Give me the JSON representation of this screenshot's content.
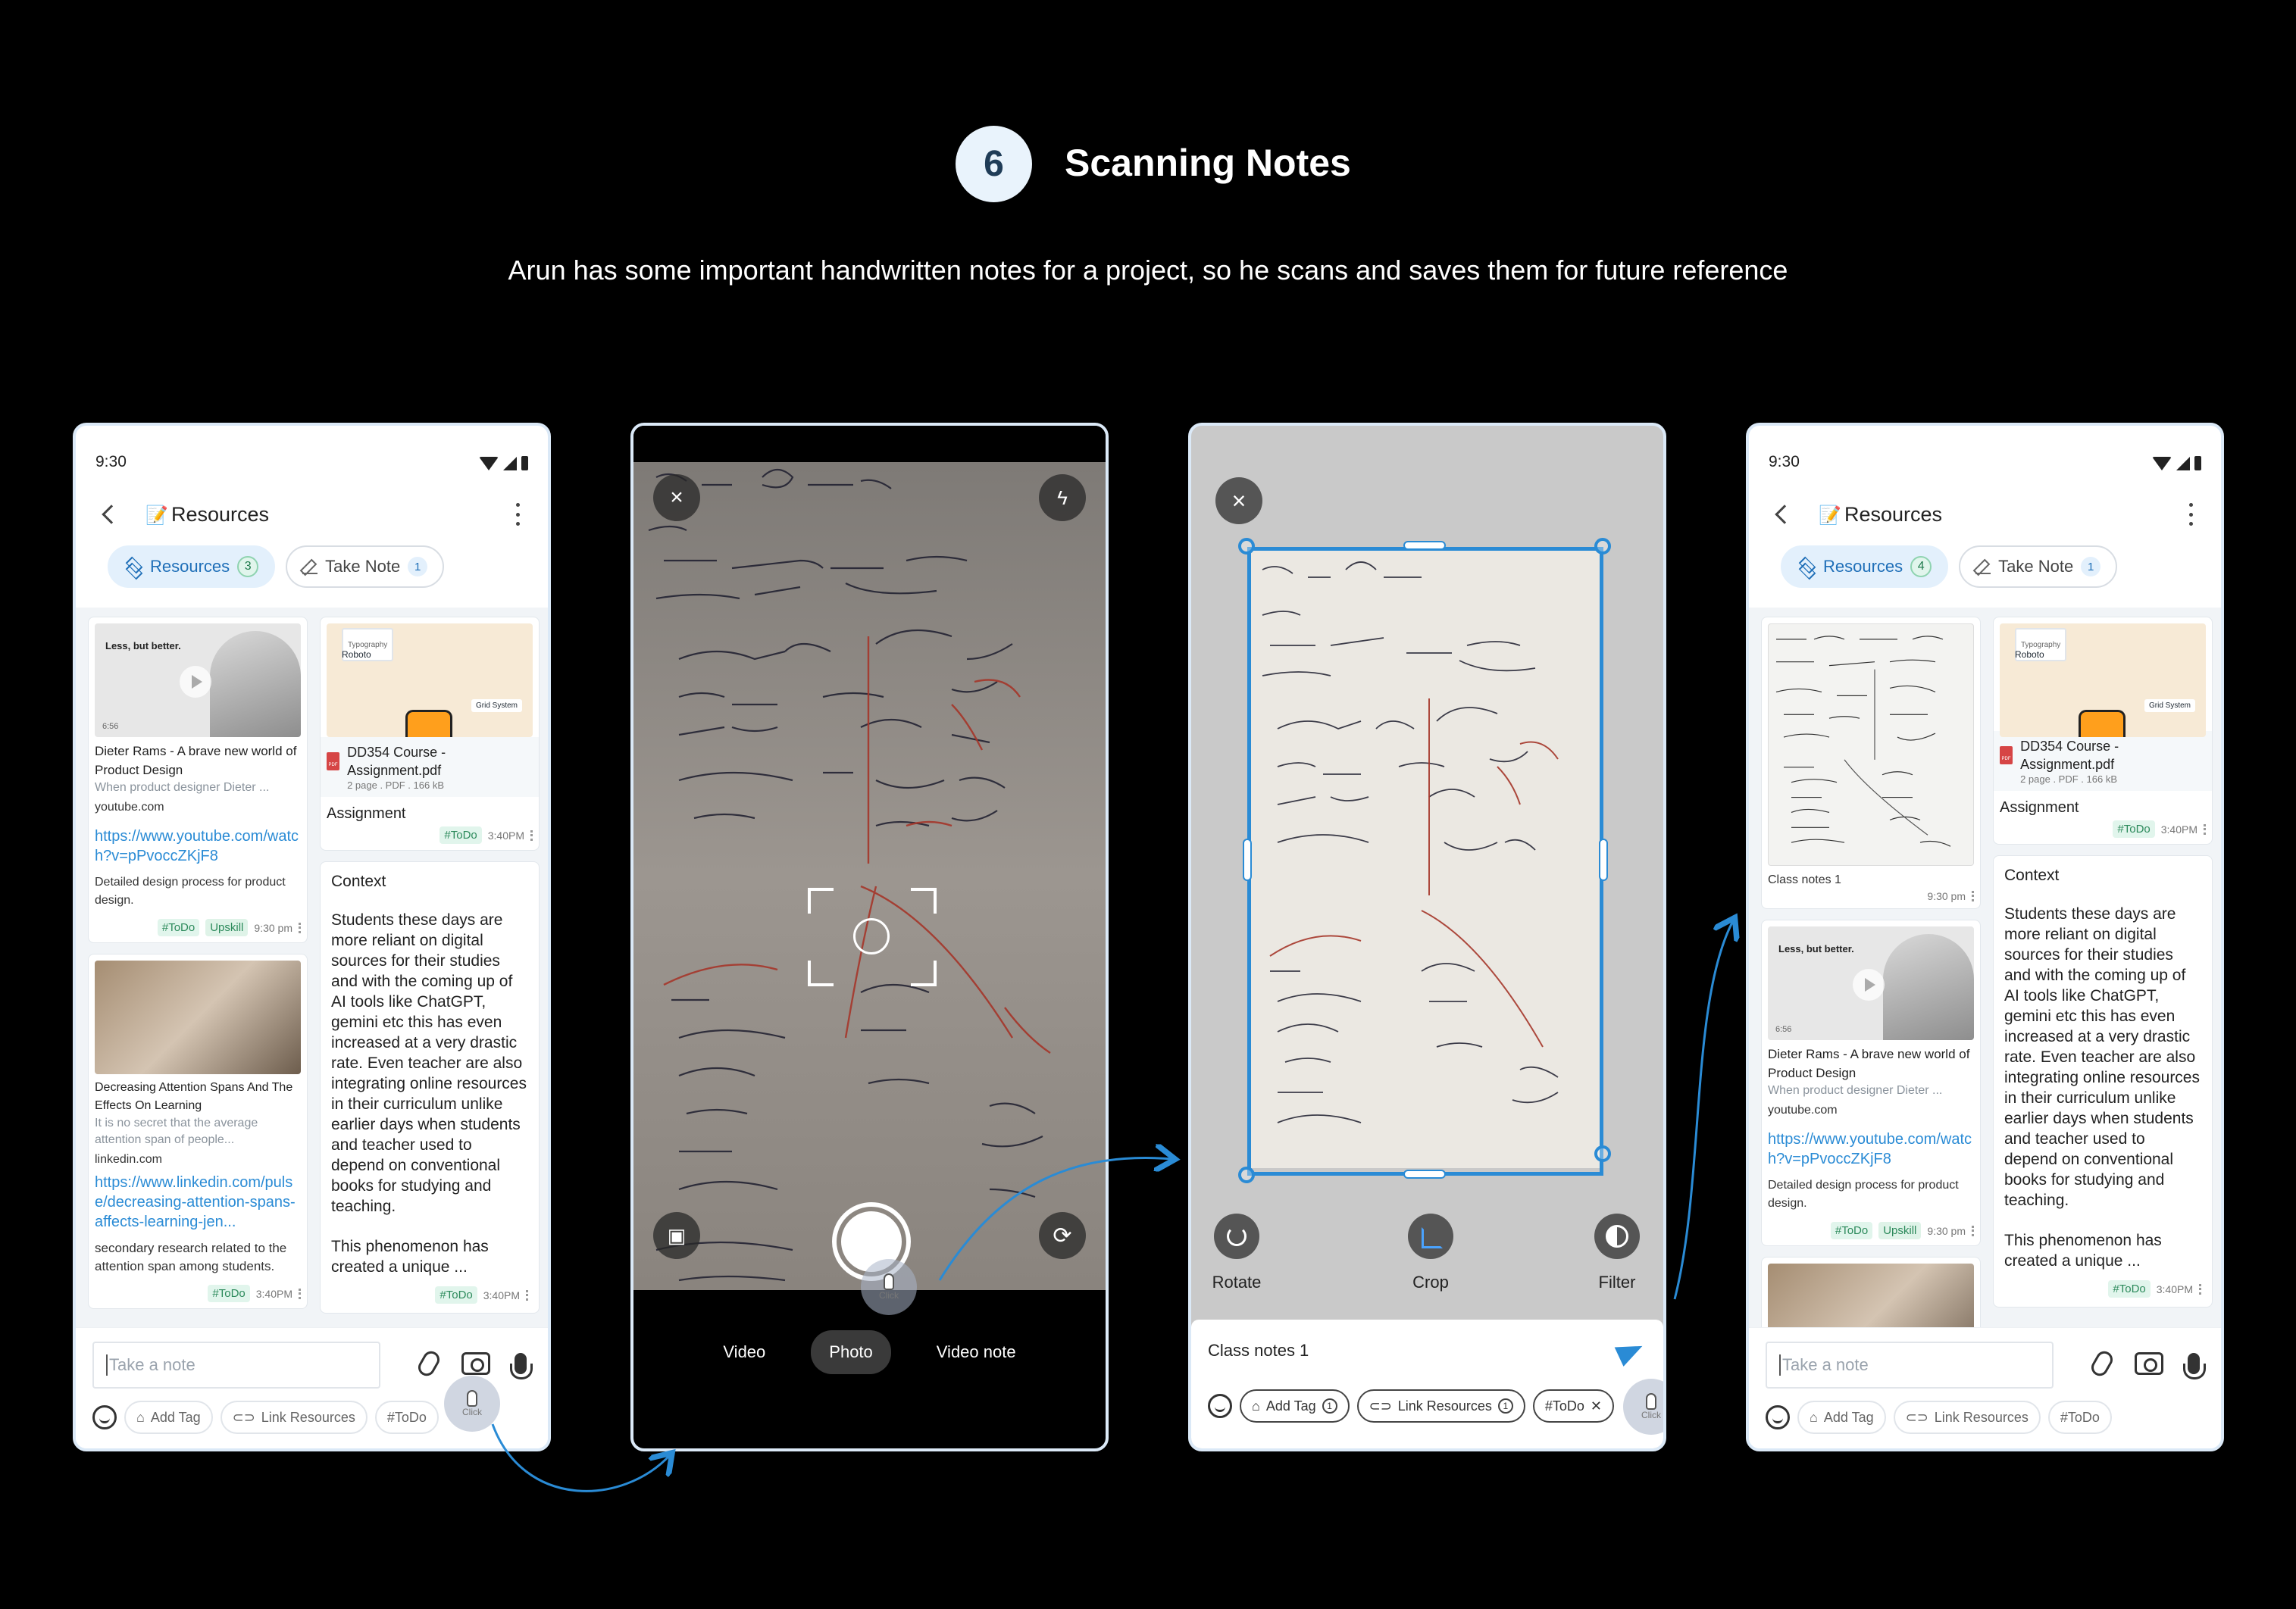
{
  "step": {
    "number": "6",
    "title": "Scanning Notes"
  },
  "subtitle": "Arun has some important handwritten notes for a project, so he scans and saves them for future reference",
  "colors": {
    "background": "#000000",
    "accent": "#2a8bd5",
    "tag_green": "#2c8a5b"
  },
  "app": {
    "time": "9:30",
    "title": "Resources",
    "title_icon": "memo-icon",
    "tab_resources": "Resources",
    "tab_take_note": "Take Note",
    "take_note_count": "1",
    "composer_placeholder": "Take a note",
    "chip_add_tag": "Add Tag",
    "chip_link_resources": "Link Resources",
    "chip_todo": "#ToDo",
    "click_label": "Click"
  },
  "screen1": {
    "resources_count": "3",
    "video_card": {
      "thumb_label": "Less, but better.",
      "duration": "6:56",
      "title": "Dieter Rams - A brave new world of Product Design",
      "desc": "When product designer Dieter ...",
      "source": "youtube.com",
      "link": "https://www.youtube.com/watch?v=pPvoccZKjF8",
      "note": "Detailed design process for product design.",
      "tags": [
        "#ToDo",
        "Upskill"
      ],
      "time": "9:30 pm"
    },
    "article_card": {
      "title": "Decreasing Attention Spans And The Effects On Learning",
      "desc": "It is no secret that the average attention span of people...",
      "source": "linkedin.com",
      "link": "https://www.linkedin.com/pulse/decreasing-attention-spans-affects-learning-jen...",
      "note": "secondary research related to the attention span among students.",
      "tag": "#ToDo",
      "time": "3:40PM"
    },
    "file_card": {
      "chip": "Typography",
      "font": "Roboto",
      "grid": "Grid System",
      "filename": "DD354 Course - Assignment.pdf",
      "meta": "2 page . PDF . 166 kB",
      "label": "Assignment",
      "tag": "#ToDo",
      "time": "3:40PM"
    },
    "context_card": {
      "title": "Context",
      "body": "Students these days are more reliant on digital sources for their studies and with the coming up of AI tools like ChatGPT, gemini etc this has even increased at a very drastic rate. Even teacher are also integrating online resources in their curriculum unlike earlier days when students and teacher used to depend on conventional books for studying and teaching.",
      "body2": "This phenomenon has created a unique ...",
      "tag": "#ToDo",
      "time": "3:40PM"
    }
  },
  "camera": {
    "modes": [
      "Video",
      "Photo",
      "Video note"
    ],
    "selected": "Photo"
  },
  "crop": {
    "tools": [
      "Rotate",
      "Crop",
      "Filter"
    ],
    "note_name": "Class notes 1",
    "add_tag_count": "1",
    "link_count": "1"
  },
  "screen4": {
    "resources_count": "4",
    "scan_card": {
      "title": "Class notes 1",
      "time": "9:30 pm"
    }
  }
}
